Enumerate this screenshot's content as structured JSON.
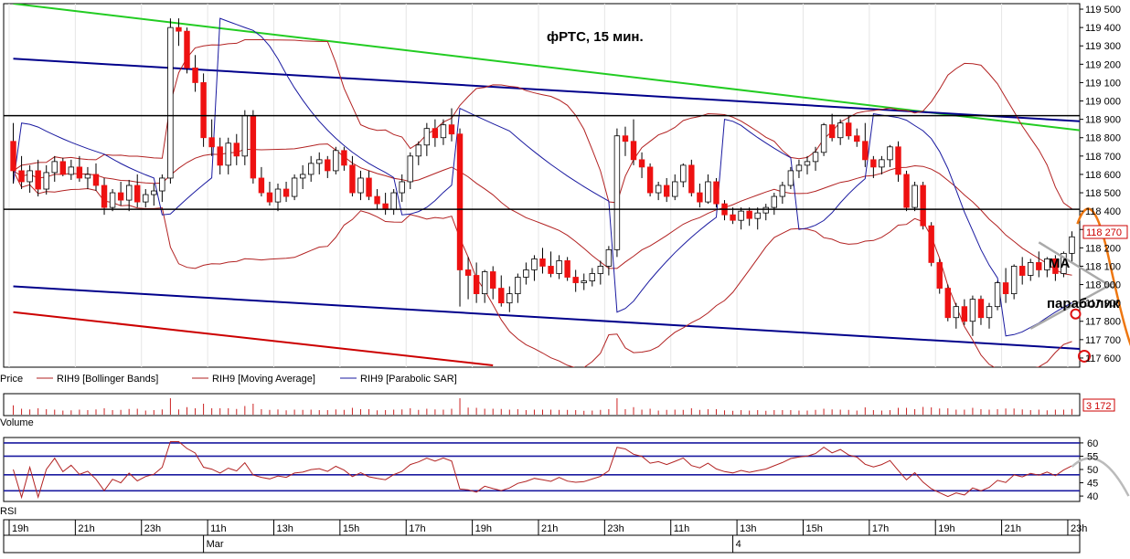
{
  "chart_data": {
    "type": "candlestick",
    "title": "фРТС,  15 мин.",
    "instrument": "RIH9",
    "price_axis": {
      "ticks": [
        "119 500",
        "119 400",
        "119 300",
        "119 200",
        "119 100",
        "119 000",
        "118 900",
        "118 800",
        "118 700",
        "118 600",
        "118 500",
        "118 400",
        "118 300",
        "118 200",
        "118 100",
        "118 000",
        "117 900",
        "117 800",
        "117 700",
        "117 600"
      ],
      "ylim": [
        117550,
        119530
      ],
      "last_price": "118 270"
    },
    "legend": [
      {
        "label": "Price",
        "color": "#000000"
      },
      {
        "label": "RIH9 [Bollinger Bands]",
        "color": "#b22222"
      },
      {
        "label": "RIH9 [Moving Average]",
        "color": "#b22222"
      },
      {
        "label": "RIH9 [Parabolic SAR]",
        "color": "#1a1aa0"
      }
    ],
    "volume_panel": {
      "label": "Volume",
      "last_value": "3 172"
    },
    "rsi_panel": {
      "label": "RSI",
      "ticks": [
        "60",
        "55",
        "50",
        "45",
        "40"
      ],
      "levels": [
        60,
        55,
        48,
        42
      ]
    },
    "time_axis": {
      "hour_labels": [
        "19h",
        "21h",
        "23h",
        "11h",
        "13h",
        "15h",
        "17h",
        "19h",
        "21h",
        "23h",
        "11h",
        "13h",
        "15h",
        "17h",
        "19h",
        "21h",
        "23h"
      ],
      "date_labels": [
        "Mar",
        "4"
      ]
    },
    "horizontal_levels": [
      118920,
      118410
    ],
    "trendlines": [
      {
        "color": "#22cc22",
        "from": [
          0,
          119530
        ],
        "to": [
          144,
          118760
        ]
      },
      {
        "color": "#00008b",
        "from": [
          0,
          119230
        ],
        "to": [
          144,
          118850
        ]
      },
      {
        "color": "#00008b",
        "from": [
          0,
          117990
        ],
        "to": [
          144,
          117610
        ]
      },
      {
        "color": "#cc0000",
        "from": [
          0,
          117850
        ],
        "to": [
          58,
          117560
        ]
      }
    ],
    "annotations": [
      "MA",
      "параболик"
    ],
    "colors": {
      "bull": "#ffffff",
      "bear": "#ee1111",
      "bollinger": "#b22222",
      "sar": "#1a1aa0",
      "green": "#22cc22",
      "forecast": "#ee7711"
    },
    "candles": [
      [
        118780,
        118880,
        118550,
        118620
      ],
      [
        118620,
        118700,
        118520,
        118560
      ],
      [
        118560,
        118650,
        118500,
        118620
      ],
      [
        118620,
        118680,
        118480,
        118520
      ],
      [
        118520,
        118650,
        118490,
        118610
      ],
      [
        118610,
        118700,
        118560,
        118670
      ],
      [
        118670,
        118690,
        118590,
        118600
      ],
      [
        118600,
        118680,
        118570,
        118640
      ],
      [
        118640,
        118700,
        118560,
        118580
      ],
      [
        118580,
        118640,
        118520,
        118600
      ],
      [
        118600,
        118660,
        118510,
        118540
      ],
      [
        118540,
        118580,
        118380,
        118420
      ],
      [
        118420,
        118520,
        118400,
        118500
      ],
      [
        118500,
        118560,
        118430,
        118460
      ],
      [
        118460,
        118570,
        118400,
        118540
      ],
      [
        118540,
        118600,
        118420,
        118450
      ],
      [
        118450,
        118520,
        118420,
        118490
      ],
      [
        118490,
        118550,
        118430,
        118510
      ],
      [
        118510,
        118600,
        118450,
        118580
      ],
      [
        118580,
        119450,
        118550,
        119400
      ],
      [
        119400,
        119450,
        119300,
        119380
      ],
      [
        119380,
        119400,
        119150,
        119180
      ],
      [
        119180,
        119250,
        119050,
        119100
      ],
      [
        119100,
        119150,
        118750,
        118800
      ],
      [
        118800,
        118900,
        118700,
        118750
      ],
      [
        118750,
        118800,
        118600,
        118650
      ],
      [
        118650,
        118800,
        118600,
        118770
      ],
      [
        118770,
        118820,
        118650,
        118700
      ],
      [
        118700,
        118950,
        118650,
        118920
      ],
      [
        118920,
        118950,
        118550,
        118580
      ],
      [
        118580,
        118640,
        118480,
        118500
      ],
      [
        118500,
        118560,
        118430,
        118450
      ],
      [
        118450,
        118550,
        118400,
        118520
      ],
      [
        118520,
        118560,
        118450,
        118480
      ],
      [
        118480,
        118600,
        118460,
        118580
      ],
      [
        118580,
        118650,
        118520,
        118600
      ],
      [
        118600,
        118700,
        118560,
        118660
      ],
      [
        118660,
        118720,
        118600,
        118680
      ],
      [
        118680,
        118700,
        118580,
        118620
      ],
      [
        118620,
        118750,
        118600,
        118730
      ],
      [
        118730,
        118750,
        118620,
        118650
      ],
      [
        118650,
        118700,
        118480,
        118500
      ],
      [
        118500,
        118620,
        118460,
        118580
      ],
      [
        118580,
        118620,
        118460,
        118480
      ],
      [
        118480,
        118520,
        118410,
        118440
      ],
      [
        118440,
        118500,
        118380,
        118410
      ],
      [
        118410,
        118520,
        118380,
        118500
      ],
      [
        118500,
        118600,
        118450,
        118560
      ],
      [
        118560,
        118720,
        118520,
        118700
      ],
      [
        118700,
        118780,
        118650,
        118760
      ],
      [
        118760,
        118880,
        118700,
        118850
      ],
      [
        118850,
        118900,
        118750,
        118800
      ],
      [
        118800,
        118900,
        118760,
        118870
      ],
      [
        118870,
        118960,
        118780,
        118820
      ],
      [
        118820,
        118850,
        117880,
        118080
      ],
      [
        118080,
        118150,
        117920,
        118050
      ],
      [
        118050,
        118120,
        117900,
        117950
      ],
      [
        117950,
        118080,
        117900,
        118070
      ],
      [
        118070,
        118100,
        117920,
        117980
      ],
      [
        117980,
        118050,
        117880,
        117900
      ],
      [
        117900,
        117990,
        117850,
        117950
      ],
      [
        117950,
        118060,
        117900,
        118040
      ],
      [
        118040,
        118120,
        118000,
        118080
      ],
      [
        118080,
        118160,
        118020,
        118140
      ],
      [
        118140,
        118200,
        118060,
        118100
      ],
      [
        118100,
        118180,
        118040,
        118060
      ],
      [
        118060,
        118160,
        118030,
        118130
      ],
      [
        118130,
        118150,
        118020,
        118040
      ],
      [
        118040,
        118080,
        117960,
        118010
      ],
      [
        118010,
        118060,
        117970,
        118020
      ],
      [
        118020,
        118090,
        117990,
        118060
      ],
      [
        118060,
        118130,
        118000,
        118100
      ],
      [
        118100,
        118210,
        118050,
        118190
      ],
      [
        118190,
        118850,
        118150,
        118810
      ],
      [
        118810,
        118860,
        118700,
        118780
      ],
      [
        118780,
        118900,
        118650,
        118680
      ],
      [
        118680,
        118720,
        118580,
        118640
      ],
      [
        118640,
        118660,
        118480,
        118500
      ],
      [
        118500,
        118560,
        118460,
        118540
      ],
      [
        118540,
        118580,
        118450,
        118480
      ],
      [
        118480,
        118600,
        118460,
        118560
      ],
      [
        118560,
        118660,
        118530,
        118650
      ],
      [
        118650,
        118680,
        118480,
        118500
      ],
      [
        118500,
        118550,
        118420,
        118450
      ],
      [
        118450,
        118600,
        118440,
        118560
      ],
      [
        118560,
        118580,
        118420,
        118440
      ],
      [
        118440,
        118460,
        118350,
        118380
      ],
      [
        118380,
        118420,
        118330,
        118350
      ],
      [
        118350,
        118420,
        118300,
        118400
      ],
      [
        118400,
        118420,
        118320,
        118360
      ],
      [
        118360,
        118420,
        118300,
        118390
      ],
      [
        118390,
        118440,
        118350,
        118420
      ],
      [
        118420,
        118500,
        118380,
        118480
      ],
      [
        118480,
        118560,
        118440,
        118540
      ],
      [
        118540,
        118640,
        118520,
        118620
      ],
      [
        118620,
        118680,
        118580,
        118650
      ],
      [
        118650,
        118700,
        118600,
        118670
      ],
      [
        118670,
        118750,
        118620,
        118720
      ],
      [
        118720,
        118880,
        118700,
        118870
      ],
      [
        118870,
        118930,
        118780,
        118800
      ],
      [
        118800,
        118900,
        118760,
        118880
      ],
      [
        118880,
        118920,
        118790,
        118810
      ],
      [
        118810,
        118850,
        118750,
        118780
      ],
      [
        118780,
        118880,
        118640,
        118680
      ],
      [
        118680,
        118700,
        118580,
        118640
      ],
      [
        118640,
        118700,
        118600,
        118680
      ],
      [
        118680,
        118760,
        118640,
        118750
      ],
      [
        118750,
        118780,
        118560,
        118600
      ],
      [
        118600,
        118620,
        118400,
        118420
      ],
      [
        118420,
        118560,
        118400,
        118540
      ],
      [
        118540,
        118560,
        118300,
        118320
      ],
      [
        118320,
        118340,
        118100,
        118120
      ],
      [
        118120,
        118140,
        117950,
        117980
      ],
      [
        117980,
        118000,
        117800,
        117820
      ],
      [
        117820,
        117900,
        117760,
        117880
      ],
      [
        117880,
        117920,
        117780,
        117800
      ],
      [
        117800,
        117940,
        117720,
        117920
      ],
      [
        117920,
        117940,
        117780,
        117820
      ],
      [
        117820,
        117900,
        117760,
        117880
      ],
      [
        117880,
        118020,
        117860,
        118010
      ],
      [
        118010,
        118090,
        117900,
        117950
      ],
      [
        117950,
        118110,
        117920,
        118100
      ],
      [
        118100,
        118150,
        118000,
        118050
      ],
      [
        118050,
        118140,
        118020,
        118120
      ],
      [
        118120,
        118180,
        118040,
        118080
      ],
      [
        118080,
        118150,
        118040,
        118140
      ],
      [
        118140,
        118160,
        118020,
        118060
      ],
      [
        118060,
        118180,
        118040,
        118170
      ],
      [
        118170,
        118290,
        118120,
        118260
      ]
    ]
  }
}
